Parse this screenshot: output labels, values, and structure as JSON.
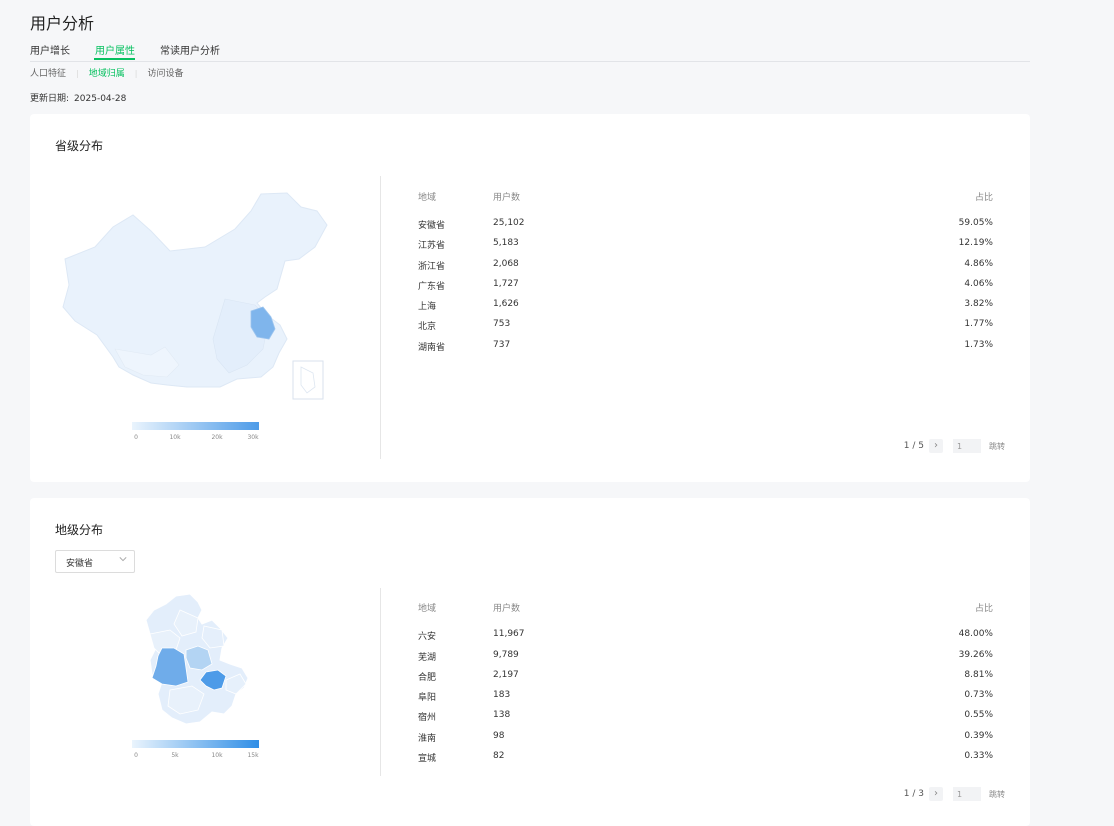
{
  "page": {
    "title": "用户分析"
  },
  "tabs": [
    {
      "label": "用户增长"
    },
    {
      "label": "用户属性"
    },
    {
      "label": "常读用户分析"
    }
  ],
  "subtabs": [
    {
      "label": "人口特征"
    },
    {
      "label": "地域归属"
    },
    {
      "label": "访问设备"
    }
  ],
  "update": {
    "label": "更新日期:",
    "date": "2025-04-28"
  },
  "province_card": {
    "title": "省级分布",
    "legend_labels": [
      "0",
      "10k",
      "20k",
      "30k"
    ],
    "columns": {
      "region": "地域",
      "users": "用户数",
      "ratio": "占比"
    },
    "rows": [
      {
        "region": "安徽省",
        "users": "25,102",
        "ratio": "59.05%"
      },
      {
        "region": "江苏省",
        "users": "5,183",
        "ratio": "12.19%"
      },
      {
        "region": "浙江省",
        "users": "2,068",
        "ratio": "4.86%"
      },
      {
        "region": "广东省",
        "users": "1,727",
        "ratio": "4.06%"
      },
      {
        "region": "上海",
        "users": "1,626",
        "ratio": "3.82%"
      },
      {
        "region": "北京",
        "users": "753",
        "ratio": "1.77%"
      },
      {
        "region": "湖南省",
        "users": "737",
        "ratio": "1.73%"
      }
    ],
    "pager": {
      "text": "1 / 5",
      "input_value": "1",
      "jump": "跳转"
    }
  },
  "city_card": {
    "title": "地级分布",
    "select_value": "安徽省",
    "legend_labels": [
      "0",
      "5k",
      "10k",
      "15k"
    ],
    "columns": {
      "region": "地域",
      "users": "用户数",
      "ratio": "占比"
    },
    "rows": [
      {
        "region": "六安",
        "users": "11,967",
        "ratio": "48.00%"
      },
      {
        "region": "芜湖",
        "users": "9,789",
        "ratio": "39.26%"
      },
      {
        "region": "合肥",
        "users": "2,197",
        "ratio": "8.81%"
      },
      {
        "region": "阜阳",
        "users": "183",
        "ratio": "0.73%"
      },
      {
        "region": "宿州",
        "users": "138",
        "ratio": "0.55%"
      },
      {
        "region": "淮南",
        "users": "98",
        "ratio": "0.39%"
      },
      {
        "region": "宣城",
        "users": "82",
        "ratio": "0.33%"
      }
    ],
    "pager": {
      "text": "1 / 3",
      "input_value": "1",
      "jump": "跳转"
    }
  },
  "colors": {
    "accent": "#07c160",
    "map_light": "#e8f2fc",
    "map_high": "#7fb5ec",
    "map_mid": "#a9cdf2"
  }
}
